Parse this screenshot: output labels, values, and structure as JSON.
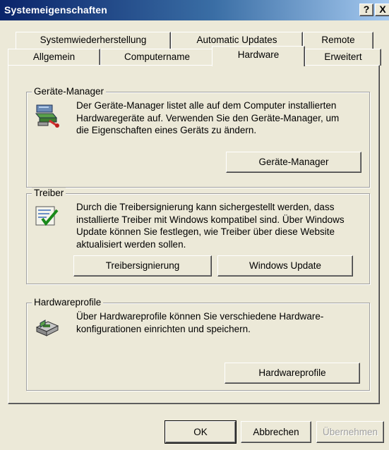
{
  "window": {
    "title": "Systemeigenschaften",
    "help_label": "?",
    "close_label": "X"
  },
  "tabs_row1": [
    {
      "label": "Systemwiederherstellung"
    },
    {
      "label": "Automatic Updates"
    },
    {
      "label": "Remote"
    }
  ],
  "tabs_row2": [
    {
      "label": "Allgemein"
    },
    {
      "label": "Computername"
    },
    {
      "label": "Hardware",
      "selected": true
    },
    {
      "label": "Erweitert"
    }
  ],
  "device_manager": {
    "title": "Geräte-Manager",
    "line1": "Der Geräte-Manager listet alle auf dem Computer installierten",
    "line2": "Hardwaregeräte auf. Verwenden Sie den Geräte-Manager, um",
    "line3": "die Eigenschaften eines Geräts zu ändern.",
    "button": "Geräte-Manager",
    "icon": "device-manager-icon"
  },
  "drivers": {
    "title": "Treiber",
    "line1": "Durch die Treibersignierung kann sichergestellt werden, dass",
    "line2": "installierte Treiber mit Windows kompatibel sind. Über Windows",
    "line3": "Update können Sie festlegen, wie Treiber über diese Website",
    "line4": "aktualisiert werden sollen.",
    "signing_button": "Treibersignierung",
    "update_button": "Windows Update",
    "icon": "driver-signing-icon"
  },
  "hardware_profiles": {
    "title": "Hardwareprofile",
    "line1": "Über Hardwareprofile können Sie verschiedene Hardware-",
    "line2": "konfigurationen einrichten und speichern.",
    "button": "Hardwareprofile",
    "icon": "hardware-profile-icon"
  },
  "footer": {
    "ok": "OK",
    "cancel": "Abbrechen",
    "apply": "Übernehmen",
    "apply_enabled": false
  },
  "colors": {
    "face": "#ece9d8",
    "title_start": "#0a246a",
    "title_end": "#a6caf0"
  }
}
